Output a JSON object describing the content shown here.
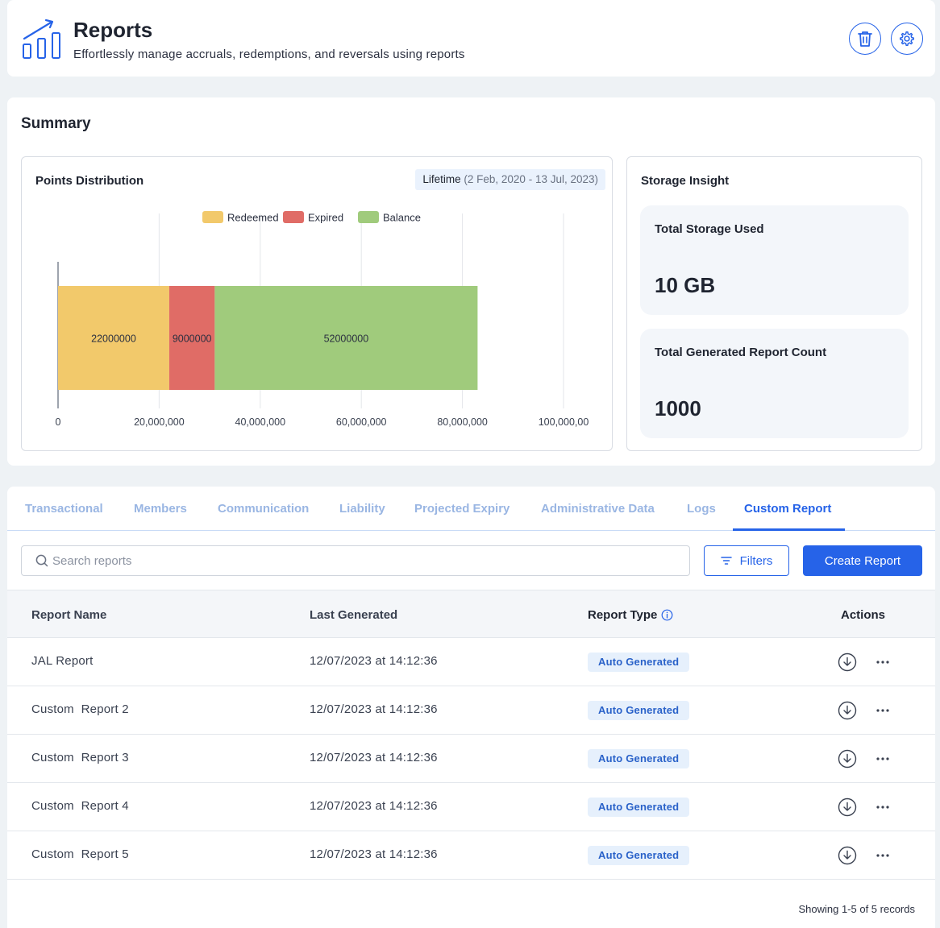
{
  "header": {
    "title": "Reports",
    "subtitle": "Effortlessly manage accruals, redemptions, and reversals using reports",
    "logo_icon": "chart-growth-icon",
    "delete_icon": "trash-icon",
    "settings_icon": "gear-icon"
  },
  "summary": {
    "title": "Summary",
    "points": {
      "title": "Points Distribution",
      "lifetime_label": "Lifetime",
      "lifetime_range": "(2 Feb, 2020 - 13 Jul, 2023)"
    },
    "storage": {
      "title": "Storage Insight",
      "used_label": "Total Storage Used",
      "used_value": "10 GB",
      "count_label": "Total Generated Report Count",
      "count_value": "1000"
    }
  },
  "chart_data": {
    "type": "bar",
    "orientation": "horizontal",
    "stacked": true,
    "series": [
      {
        "name": "Redeemed",
        "values": [
          22000000
        ],
        "color": "#f2c96b"
      },
      {
        "name": "Expired",
        "values": [
          9000000
        ],
        "color": "#e06c66"
      },
      {
        "name": "Balance",
        "values": [
          52000000
        ],
        "color": "#a0cb7c"
      }
    ],
    "xlim": [
      0,
      100000000
    ],
    "xticks": [
      0,
      20000000,
      40000000,
      60000000,
      80000000,
      100000000
    ],
    "xtick_labels": [
      "0",
      "20,000,000",
      "40,000,000",
      "60,000,000",
      "80,000,000",
      "100,000,00"
    ],
    "legend_position": "top",
    "grid": true
  },
  "tabs": [
    {
      "label": "Transactional",
      "active": false
    },
    {
      "label": "Members",
      "active": false
    },
    {
      "label": "Communication",
      "active": false
    },
    {
      "label": "Liability",
      "active": false
    },
    {
      "label": "Projected Expiry",
      "active": false
    },
    {
      "label": "Administrative Data",
      "active": false
    },
    {
      "label": "Logs",
      "active": false
    },
    {
      "label": "Custom Report",
      "active": true
    }
  ],
  "toolbar": {
    "search_placeholder": "Search reports",
    "filters_label": "Filters",
    "create_label": "Create Report"
  },
  "table": {
    "columns": [
      "Report Name",
      "Last Generated",
      "Report Type",
      "Actions"
    ],
    "rows": [
      {
        "name": "JAL Report",
        "last_generated": "12/07/2023 at 14:12:36",
        "type": "Auto Generated"
      },
      {
        "name": "Custom  Report 2",
        "last_generated": "12/07/2023 at 14:12:36",
        "type": "Auto Generated"
      },
      {
        "name": "Custom  Report 3",
        "last_generated": "12/07/2023 at 14:12:36",
        "type": "Auto Generated"
      },
      {
        "name": "Custom  Report 4",
        "last_generated": "12/07/2023 at 14:12:36",
        "type": "Auto Generated"
      },
      {
        "name": "Custom  Report 5",
        "last_generated": "12/07/2023 at 14:12:36",
        "type": "Auto Generated"
      }
    ],
    "footer": "Showing 1-5 of 5 records"
  },
  "colors": {
    "primary": "#2663e8",
    "tab_inactive": "#9ab6e3",
    "badge_bg": "#e6f0fc"
  }
}
